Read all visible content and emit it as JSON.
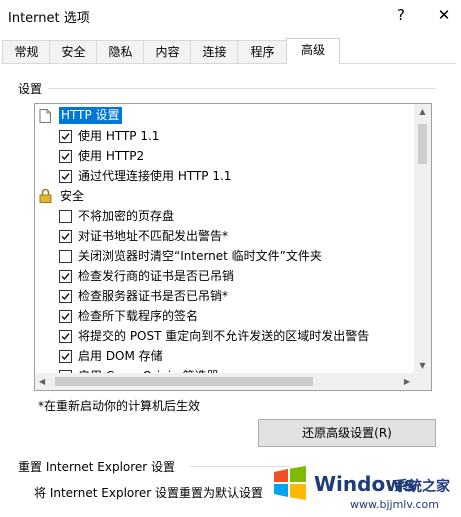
{
  "window": {
    "title": "Internet 选项",
    "help_glyph": "?",
    "close_glyph": "✕"
  },
  "tabs": [
    {
      "label": "常规"
    },
    {
      "label": "安全"
    },
    {
      "label": "隐私"
    },
    {
      "label": "内容"
    },
    {
      "label": "连接"
    },
    {
      "label": "程序"
    },
    {
      "label": "高级",
      "active": true
    }
  ],
  "settings": {
    "group_label": "设置",
    "items": [
      {
        "kind": "category",
        "icon": "page-icon",
        "label": "HTTP 设置",
        "selected": true
      },
      {
        "kind": "checkbox",
        "label": "使用 HTTP 1.1",
        "checked": true
      },
      {
        "kind": "checkbox",
        "label": "使用 HTTP2",
        "checked": true
      },
      {
        "kind": "checkbox",
        "label": "通过代理连接使用 HTTP 1.1",
        "checked": true
      },
      {
        "kind": "category",
        "icon": "lock-icon",
        "label": "安全",
        "selected": false
      },
      {
        "kind": "checkbox",
        "label": "不将加密的页存盘",
        "checked": false
      },
      {
        "kind": "checkbox",
        "label": "对证书地址不匹配发出警告*",
        "checked": true
      },
      {
        "kind": "checkbox",
        "label": "关闭浏览器时清空“Internet 临时文件”文件夹",
        "checked": false
      },
      {
        "kind": "checkbox",
        "label": "检查发行商的证书是否已吊销",
        "checked": true
      },
      {
        "kind": "checkbox",
        "label": "检查服务器证书是否已吊销*",
        "checked": true
      },
      {
        "kind": "checkbox",
        "label": "检查所下载程序的签名",
        "checked": true
      },
      {
        "kind": "checkbox",
        "label": "将提交的 POST 重定向到不允许发送的区域时发出警告",
        "checked": true
      },
      {
        "kind": "checkbox",
        "label": "启用 DOM 存储",
        "checked": true
      },
      {
        "kind": "checkbox",
        "label": "启用 Cross Origin 筛选器",
        "checked": true
      }
    ],
    "footnote": "*在重新启动你的计算机后生效",
    "restore_button": "还原高级设置(R)"
  },
  "reset_section": {
    "title": "重置 Internet Explorer 设置",
    "description": "将 Internet Explorer 设置重置为默认设置"
  },
  "watermark": {
    "brand": "Windows",
    "cn": "系统之家",
    "url": "www.bjjmlv.com"
  },
  "colors": {
    "selection": "#0078d7",
    "win_red": "#f25022",
    "win_green": "#7fba00",
    "win_blue": "#00a4ef",
    "win_yellow": "#ffb900"
  }
}
